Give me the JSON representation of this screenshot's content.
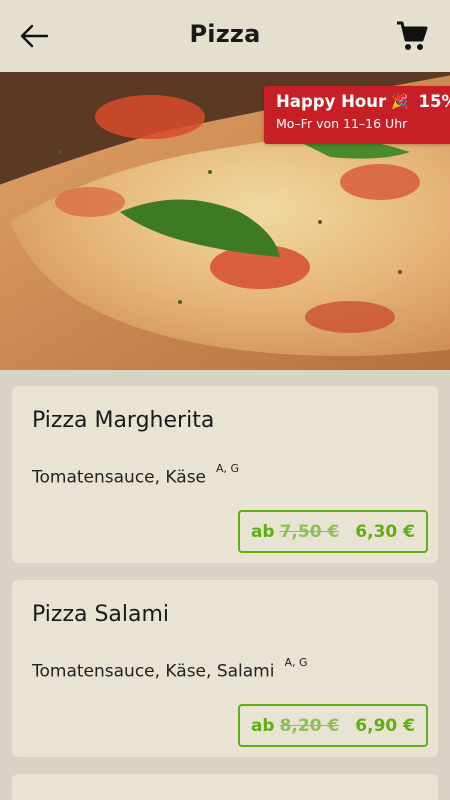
{
  "header": {
    "title": "Pizza",
    "back_icon": "arrow-left-icon",
    "cart_icon": "shopping-cart-icon"
  },
  "promo": {
    "title": "Happy Hour",
    "emoji": "🎉",
    "discount": "15%",
    "subtitle": "Mo–Fr von 11–16 Uhr",
    "color": "#c62026"
  },
  "products": [
    {
      "name": "Pizza Margherita",
      "description": "Tomatensauce, Käse",
      "allergens": "A, G",
      "price_prefix": "ab",
      "old_price": "7,50 €",
      "price": "6,30 €"
    },
    {
      "name": "Pizza Salami",
      "description": "Tomatensauce, Käse, Salami",
      "allergens": "A, G",
      "price_prefix": "ab",
      "old_price": "8,20 €",
      "price": "6,90 €"
    }
  ],
  "colors": {
    "accent": "#5fae14",
    "background": "#d8d3c4",
    "card": "#e8e3d3"
  }
}
